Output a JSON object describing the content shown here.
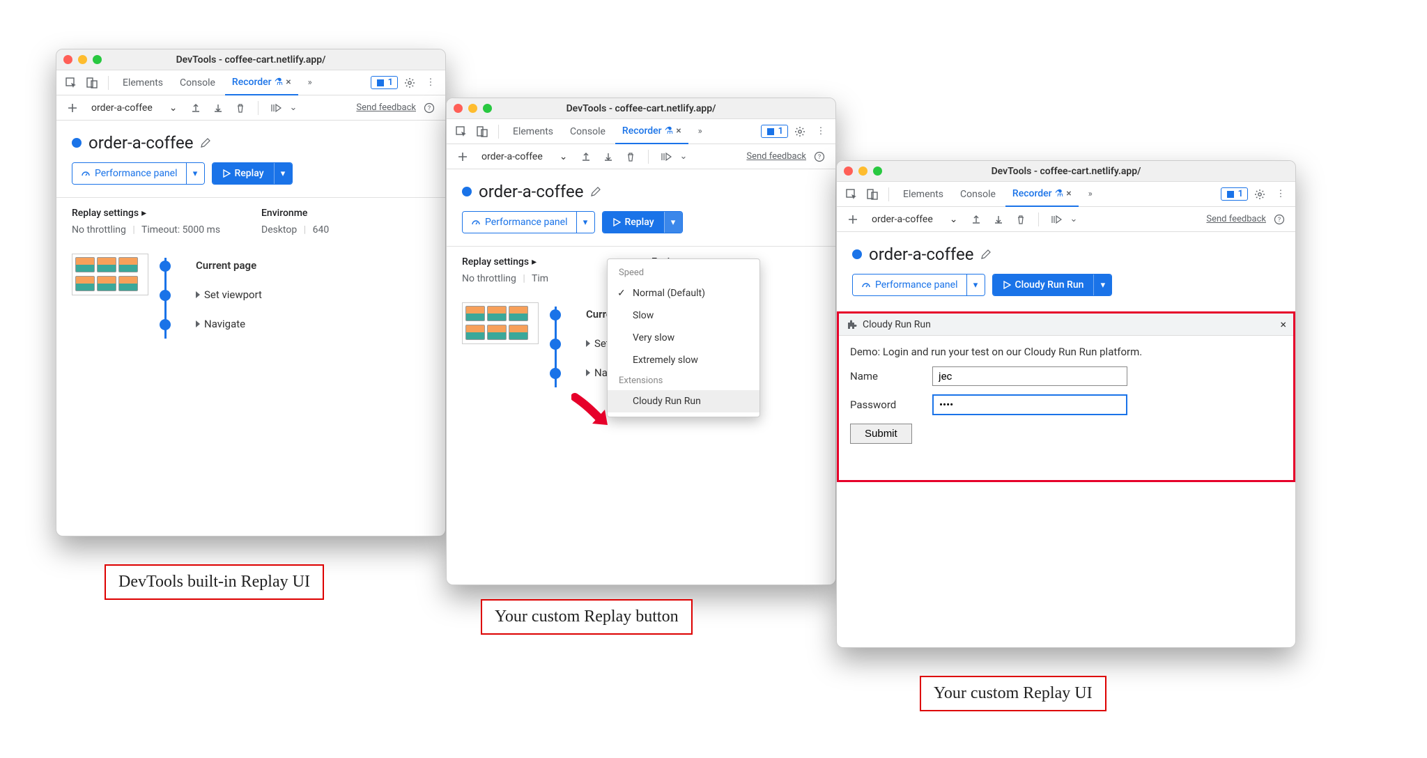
{
  "title": "DevTools - coffee-cart.netlify.app/",
  "tabs": {
    "elements": "Elements",
    "console": "Console",
    "recorder": "Recorder"
  },
  "issues_count": "1",
  "recording_select": "order-a-coffee",
  "feedback": "Send feedback",
  "recording_name": "order-a-coffee",
  "perf_panel": "Performance panel",
  "replay": "Replay",
  "replay_custom": "Cloudy Run Run",
  "settings_head": "Replay settings",
  "throttling": "No throttling",
  "timeout": "Timeout: 5000 ms",
  "env_head": "Environment",
  "env_body_1": "Desktop",
  "env_body_2": "640",
  "steps": {
    "current": "Current page",
    "viewport": "Set viewport",
    "navigate": "Navigate"
  },
  "menu": {
    "speed_head": "Speed",
    "normal": "Normal (Default)",
    "slow": "Slow",
    "very_slow": "Very slow",
    "extremely_slow": "Extremely slow",
    "ext_head": "Extensions",
    "cloudy": "Cloudy Run Run"
  },
  "ext_panel": {
    "title": "Cloudy Run Run",
    "desc": "Demo: Login and run your test on our Cloudy Run Run platform.",
    "name_label": "Name",
    "name_value": "jec",
    "pass_label": "Password",
    "pass_value": "••••",
    "submit": "Submit"
  },
  "captions": {
    "c1": "DevTools built-in Replay UI",
    "c2": "Your custom Replay button",
    "c3": "Your custom Replay UI"
  }
}
